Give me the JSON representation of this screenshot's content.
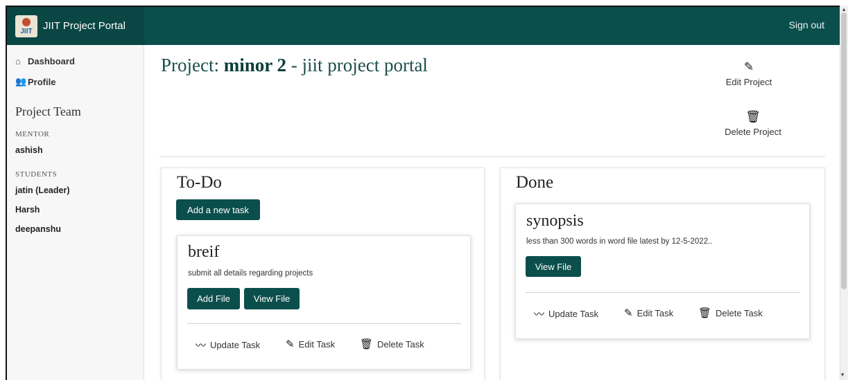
{
  "app": {
    "title": "JIIT Project Portal",
    "logo_text": "JIIT",
    "sign_out": "Sign out"
  },
  "sidebar": {
    "nav": [
      {
        "label": "Dashboard",
        "icon": "home-icon"
      },
      {
        "label": "Profile",
        "icon": "users-icon"
      }
    ],
    "team_heading": "Project Team",
    "mentor_label": "MENTOR",
    "mentor": "ashish",
    "students_label": "STUDENTS",
    "students": [
      "jatin (Leader)",
      "Harsh",
      "deepanshu"
    ]
  },
  "project": {
    "prefix": "Project: ",
    "name": "minor 2",
    "suffix": " - jiit project portal",
    "edit_label": "Edit Project",
    "delete_label": "Delete Project"
  },
  "todo": {
    "title": "To-Do",
    "add_task": "Add a new task",
    "cards": [
      {
        "title": "breif",
        "description": "submit all details regarding projects",
        "add_file": "Add File",
        "view_file": "View File",
        "update": "Update Task",
        "edit": "Edit Task",
        "delete": "Delete Task"
      }
    ]
  },
  "done": {
    "title": "Done",
    "cards": [
      {
        "title": "synopsis",
        "description": "less than 300 words in word file latest by 12-5-2022..",
        "view_file": "View File",
        "update": "Update Task",
        "edit": "Edit Task",
        "delete": "Delete Task"
      }
    ]
  },
  "colors": {
    "brand": "#0b4f4c",
    "sidebar_bg": "#f7f7f7"
  }
}
